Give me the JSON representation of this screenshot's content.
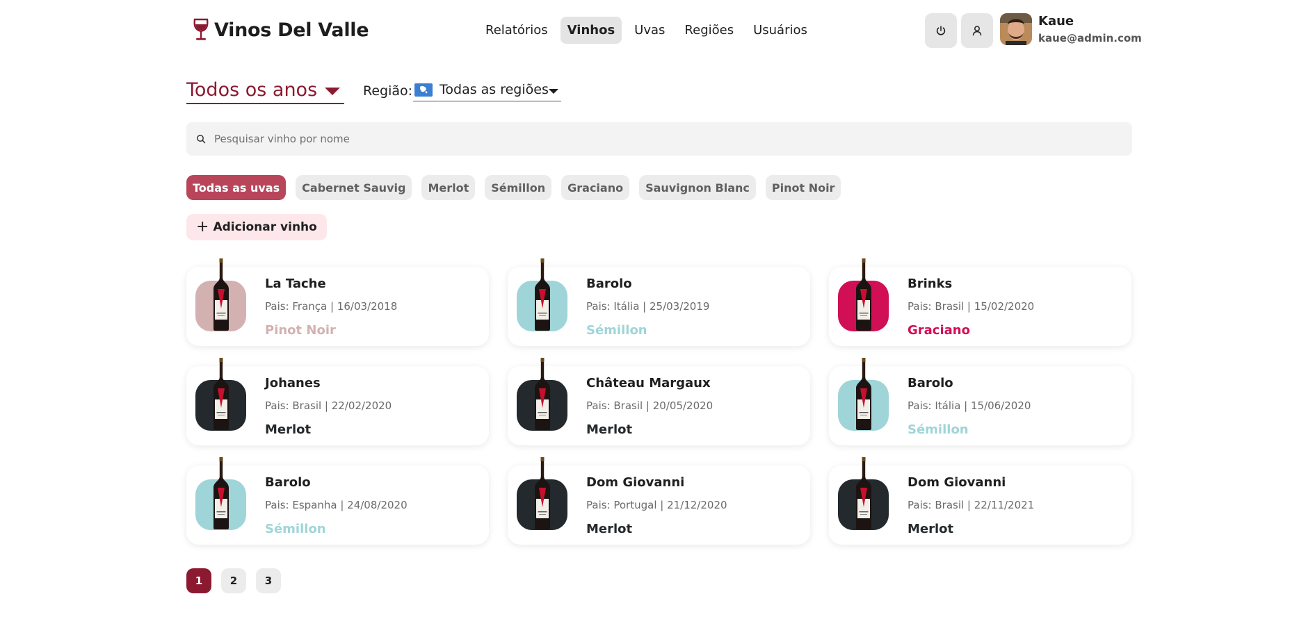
{
  "header": {
    "brand": "Vinos Del Valle",
    "nav": [
      {
        "label": "Relatórios",
        "active": false
      },
      {
        "label": "Vinhos",
        "active": true
      },
      {
        "label": "Uvas",
        "active": false
      },
      {
        "label": "Regiões",
        "active": false
      },
      {
        "label": "Usuários",
        "active": false
      }
    ],
    "user": {
      "name": "Kaue",
      "email": "kaue@admin.com"
    }
  },
  "filters": {
    "year": "Todos os anos",
    "region_label": "Região:",
    "region": "Todas as regiões"
  },
  "search": {
    "placeholder": "Pesquisar vinho por nome"
  },
  "grape_chips": [
    {
      "label": "Todas as uvas",
      "active": true
    },
    {
      "label": "Cabernet Sauvig",
      "active": false
    },
    {
      "label": "Merlot",
      "active": false
    },
    {
      "label": "Sémillon",
      "active": false
    },
    {
      "label": "Graciano",
      "active": false
    },
    {
      "label": "Sauvignon Blanc",
      "active": false
    },
    {
      "label": "Pinot Noir",
      "active": false
    }
  ],
  "add_button": {
    "label": "Adicionar vinho"
  },
  "wines": [
    {
      "name": "La Tache",
      "meta": "Pais: França | 16/03/2018",
      "grape": "Pinot Noir",
      "color": "#d4b1b1"
    },
    {
      "name": "Barolo",
      "meta": "Pais: Itália | 25/03/2019",
      "grape": "Sémillon",
      "color": "#9fd5d8"
    },
    {
      "name": "Brinks",
      "meta": "Pais: Brasil | 15/02/2020",
      "grape": "Graciano",
      "color": "#d10f55"
    },
    {
      "name": "Johanes",
      "meta": "Pais: Brasil | 22/02/2020",
      "grape": "Merlot",
      "color": "#23292c"
    },
    {
      "name": "Château Margaux",
      "meta": "Pais: Brasil | 20/05/2020",
      "grape": "Merlot",
      "color": "#23292c"
    },
    {
      "name": "Barolo",
      "meta": "Pais: Itália | 15/06/2020",
      "grape": "Sémillon",
      "color": "#9fd5d8"
    },
    {
      "name": "Barolo",
      "meta": "Pais: Espanha | 24/08/2020",
      "grape": "Sémillon",
      "color": "#9fd5d8"
    },
    {
      "name": "Dom Giovanni",
      "meta": "Pais: Portugal | 21/12/2020",
      "grape": "Merlot",
      "color": "#23292c"
    },
    {
      "name": "Dom Giovanni",
      "meta": "Pais: Brasil | 22/11/2021",
      "grape": "Merlot",
      "color": "#23292c"
    }
  ],
  "pagination": {
    "pages": [
      "1",
      "2",
      "3"
    ],
    "current": "1"
  }
}
